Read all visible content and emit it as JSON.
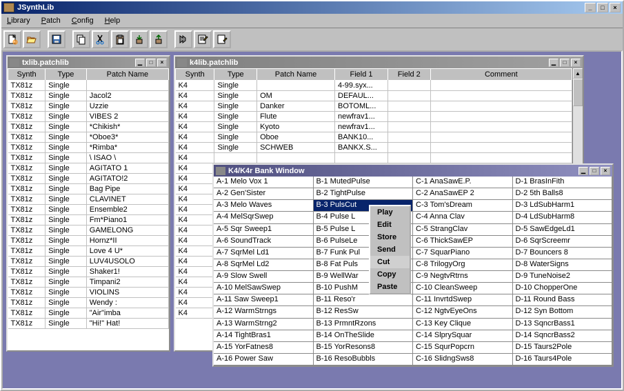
{
  "app": {
    "title": "JSynthLib"
  },
  "menus": {
    "library": "Library",
    "patch": "Patch",
    "config": "Config",
    "help": "Help"
  },
  "win1": {
    "title": "txlib.patchlib",
    "headers": [
      "Synth",
      "Type",
      "Patch Name"
    ],
    "rows": [
      [
        "TX81z",
        "Single",
        ""
      ],
      [
        "TX81z",
        "Single",
        " Jacol2"
      ],
      [
        "TX81z",
        "Single",
        " Uzzie"
      ],
      [
        "TX81z",
        "Single",
        " VIBES 2"
      ],
      [
        "TX81z",
        "Single",
        "*Chikish*"
      ],
      [
        "TX81z",
        "Single",
        "*Oboe3*"
      ],
      [
        "TX81z",
        "Single",
        "*Rimba*"
      ],
      [
        "TX81z",
        "Single",
        "\\ ISAO \\"
      ],
      [
        "TX81z",
        "Single",
        " AGITATO 1"
      ],
      [
        "TX81z",
        "Single",
        " AGITATO!2"
      ],
      [
        "TX81z",
        "Single",
        " Bag Pipe"
      ],
      [
        "TX81z",
        "Single",
        " CLAVINET"
      ],
      [
        "TX81z",
        "Single",
        " Ensemble2"
      ],
      [
        "TX81z",
        "Single",
        " Fm*Piano1"
      ],
      [
        "TX81z",
        "Single",
        " GAMELONG"
      ],
      [
        "TX81z",
        "Single",
        " Hornz*II"
      ],
      [
        "TX81z",
        "Single",
        " Love 4 U*"
      ],
      [
        "TX81z",
        "Single",
        " LUV4USOLO"
      ],
      [
        "TX81z",
        "Single",
        " Shaker1!"
      ],
      [
        "TX81z",
        "Single",
        " Timpani2"
      ],
      [
        "TX81z",
        "Single",
        " VIOLINS"
      ],
      [
        "TX81z",
        "Single",
        " Wendy :"
      ],
      [
        "TX81z",
        "Single",
        "\"Air\"imba"
      ],
      [
        "TX81z",
        "Single",
        "\"Hi!\" Hat!"
      ]
    ]
  },
  "win2": {
    "title": "k4lib.patchlib",
    "headers": [
      "Synth",
      "Type",
      "Patch Name",
      "Field 1",
      "Field 2",
      "Comment"
    ],
    "rows": [
      [
        "K4",
        "Single",
        "",
        "4-99.syx...",
        "",
        ""
      ],
      [
        "K4",
        "Single",
        "OM",
        "DEFAUL...",
        "",
        ""
      ],
      [
        "K4",
        "Single",
        "Danker",
        "BOTOML...",
        "",
        ""
      ],
      [
        "K4",
        "Single",
        "Flute",
        "newfrav1...",
        "",
        ""
      ],
      [
        "K4",
        "Single",
        "Kyoto",
        "newfrav1...",
        "",
        ""
      ],
      [
        "K4",
        "Single",
        "Oboe",
        "BANK10...",
        "",
        ""
      ],
      [
        "K4",
        "Single",
        "SCHWEB",
        "BANKX.S...",
        "",
        ""
      ],
      [
        "K4",
        "",
        "",
        "",
        "",
        ""
      ],
      [
        "K4",
        "",
        "",
        "",
        "",
        ""
      ],
      [
        "K4",
        "",
        "",
        "",
        "",
        ""
      ],
      [
        "K4",
        "",
        "",
        "",
        "",
        ""
      ],
      [
        "K4",
        "",
        "",
        "",
        "",
        ""
      ],
      [
        "K4",
        "",
        "",
        "",
        "",
        ""
      ],
      [
        "K4",
        "",
        "",
        "",
        "",
        ""
      ],
      [
        "K4",
        "",
        "",
        "",
        "",
        ""
      ],
      [
        "K4",
        "",
        "",
        "",
        "",
        ""
      ],
      [
        "K4",
        "",
        "",
        "",
        "",
        ""
      ],
      [
        "K4",
        "",
        "",
        "",
        "",
        ""
      ],
      [
        "K4",
        "",
        "",
        "",
        "",
        ""
      ],
      [
        "K4",
        "",
        "",
        "",
        "",
        ""
      ],
      [
        "K4",
        "",
        "",
        "",
        "",
        ""
      ],
      [
        "K4",
        "",
        "",
        "",
        "",
        ""
      ],
      [
        "K4",
        "",
        "",
        "",
        "",
        ""
      ]
    ]
  },
  "win3": {
    "title": "K4/K4r Bank Window",
    "colA": [
      "A-1 Melo Vox 1",
      "A-2 Gen'Sister",
      "A-3 Melo Waves",
      "A-4 MelSqrSwep",
      "A-5 Sqr Sweep1",
      "A-6 SoundTrack",
      "A-7 SqrMel Ld1",
      "A-8 SqrMel Ld2",
      "A-9 Slow Swell",
      "A-10 MelSawSwep",
      "A-11 Saw Sweep1",
      "A-12 WarmStrngs",
      "A-13 WarmStrng2",
      "A-14 TightBras1",
      "A-15 YorFatnes8",
      "A-16 Power Saw"
    ],
    "colB": [
      "B-1 MutedPulse",
      "B-2 TightPulse",
      "B-3 PulsCut",
      "B-4 Pulse L",
      "B-5 Pulse L",
      "B-6 PulseLe",
      "B-7 Funk Pul",
      "B-8 Fat Puls",
      "B-9 WellWar",
      "B-10 PushM",
      "B-11 Reso'r",
      "B-12 ResSw",
      "B-13 PrmntRzons",
      "B-14 OnTheSlide",
      "B-15 YorResons8",
      "B-16 ResoBubbls"
    ],
    "colC": [
      "C-1 AnaSawE.P.",
      "C-2 AnaSawEP 2",
      "C-3 Tom'sDream",
      "C-4 Anna Clav",
      "C-5 StrangClav",
      "C-6 ThickSawEP",
      "C-7 SquarPiano",
      "C-8 TrilogyOrg",
      "C-9 NegtvRtrns",
      "C-10 CleanSweep",
      "C-11 InvrtdSwep",
      "C-12 NgtvEyeOns",
      "C-13 Key Clique",
      "C-14 SlprySquar",
      "C-15 SqurPopcrn",
      "C-16 SlidngSws8"
    ],
    "colD": [
      "D-1 BrasInFith",
      "D-2 5th Balls8",
      "D-3 LdSubHarm1",
      "D-4 LdSubHarm8",
      "D-5 SawEdgeLd1",
      "D-6 SqrScreemr",
      "D-7 Bouncers 8",
      "D-8 WaterSigns",
      "D-9 TuneNoise2",
      "D-10 ChopperOne",
      "D-11 Round Bass",
      "D-12 Syn Bottom",
      "D-13 SqncrBass1",
      "D-14 SqncrBass2",
      "D-15 Taurs2Pole",
      "D-16 Taurs4Pole"
    ],
    "selectedB": 2
  },
  "context": {
    "items": [
      "Play",
      "Edit",
      "Store",
      "Send",
      "Cut",
      "Copy",
      "Paste"
    ],
    "highlighted": 4
  }
}
